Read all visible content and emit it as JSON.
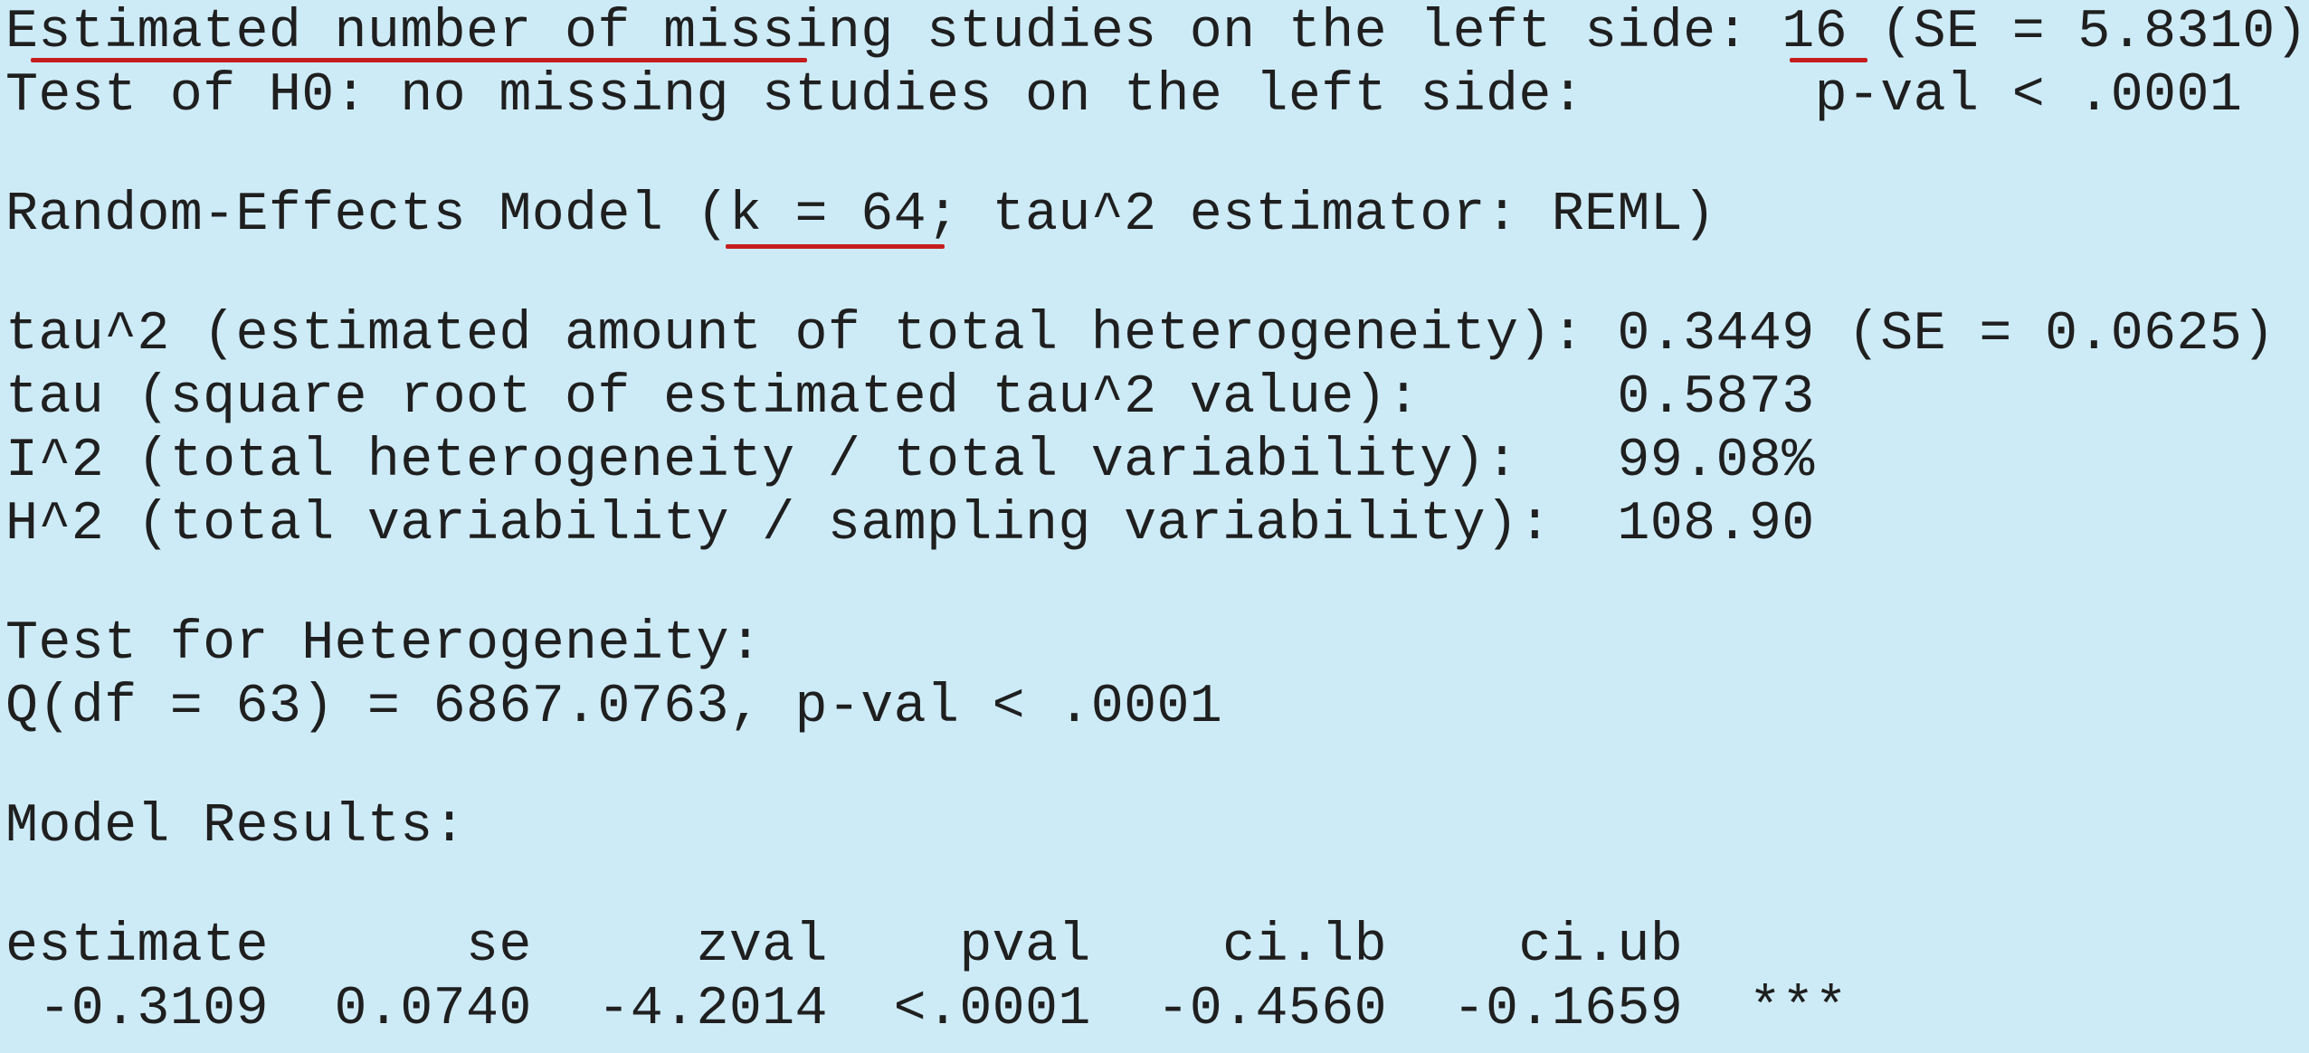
{
  "output": {
    "line_1": "Estimated number of missing studies on the left side: 16 (SE = 5.8310)",
    "line_2": "Test of H0: no missing studies on the left side:       p-val < .0001",
    "line_3": "Random-Effects Model (k = 64; tau^2 estimator: REML)",
    "line_4": "tau^2 (estimated amount of total heterogeneity): 0.3449 (SE = 0.0625)",
    "line_5": "tau (square root of estimated tau^2 value):      0.5873",
    "line_6": "I^2 (total heterogeneity / total variability):   99.08%",
    "line_7": "H^2 (total variability / sampling variability):  108.90",
    "line_8": "Test for Heterogeneity:",
    "line_9": "Q(df = 63) = 6867.0763, p-val < .0001",
    "line_10": "Model Results:",
    "line_11": "estimate      se     zval    pval    ci.lb    ci.ub",
    "line_12": " -0.3109  0.0740  -4.2014  <.0001  -0.4560  -0.1659  ***"
  },
  "colors": {
    "background": "#cdebf7",
    "text": "#1f1f1f",
    "annotation": "#c51d1d"
  }
}
